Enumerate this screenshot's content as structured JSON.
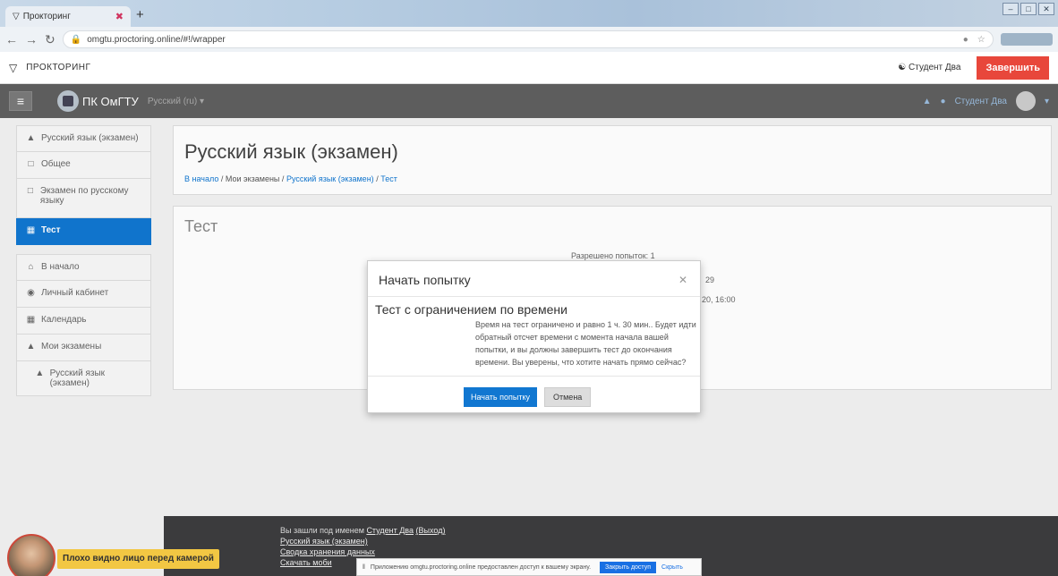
{
  "browser": {
    "tab_title": "Прокторинг",
    "url": "omgtu.proctoring.online/#!/wrapper"
  },
  "proctoring": {
    "title": "ПРОКТОРИНГ",
    "user": "Студент Два",
    "finish_label": "Завершить"
  },
  "navbar": {
    "site_name": "ПК ОмГТУ",
    "language": "Русский (ru)",
    "user": "Студент Два"
  },
  "sidebar": {
    "items": [
      {
        "label": "Русский язык (экзамен)",
        "icon": "graduation-cap-icon"
      },
      {
        "label": "Общее",
        "icon": "folder-icon"
      },
      {
        "label": "Экзамен по русскому языку",
        "icon": "folder-icon"
      },
      {
        "label": "Тест",
        "icon": "quiz-icon",
        "active": true
      }
    ],
    "nav": [
      {
        "label": "В начало",
        "icon": "home-icon"
      },
      {
        "label": "Личный кабинет",
        "icon": "dashboard-icon"
      },
      {
        "label": "Календарь",
        "icon": "calendar-icon"
      },
      {
        "label": "Мои экзамены",
        "icon": "graduation-cap-icon"
      },
      {
        "label": "Русский язык (экзамен)",
        "icon": "graduation-cap-icon"
      }
    ]
  },
  "header": {
    "title": "Русский язык (экзамен)",
    "breadcrumb": [
      "В начало",
      "Мои экзамены",
      "Русский язык (экзамен)",
      "Тест"
    ]
  },
  "main": {
    "title": "Тест",
    "attempts": "Разрешено попыток: 1",
    "fragment1": "29",
    "fragment2": "20, 16:00"
  },
  "modal": {
    "title": "Начать попытку",
    "subtitle": "Тест с ограничением по времени",
    "description": "Время на тест ограничено и равно 1 ч. 30 мин.. Будет идти обратный отсчет времени с момента начала вашей попытки, и вы должны завершить тест до окончания времени. Вы уверены, что хотите начать прямо сейчас?",
    "start_label": "Начать попытку",
    "cancel_label": "Отмена"
  },
  "footer": {
    "logged_in_prefix": "Вы зашли под именем",
    "user": "Студент Два",
    "logout": "(Выход)",
    "course_link": "Русский язык (экзамен)",
    "retention_link": "Сводка хранения данных",
    "mobile_link": "Скачать моби"
  },
  "share_bar": {
    "text": "Приложению omgtu.proctoring.online предоставлен доступ к вашему экрану.",
    "stop_label": "Закрыть доступ",
    "hide_label": "Скрыть"
  },
  "camera": {
    "warning": "Плохо видно лицо перед камерой"
  }
}
